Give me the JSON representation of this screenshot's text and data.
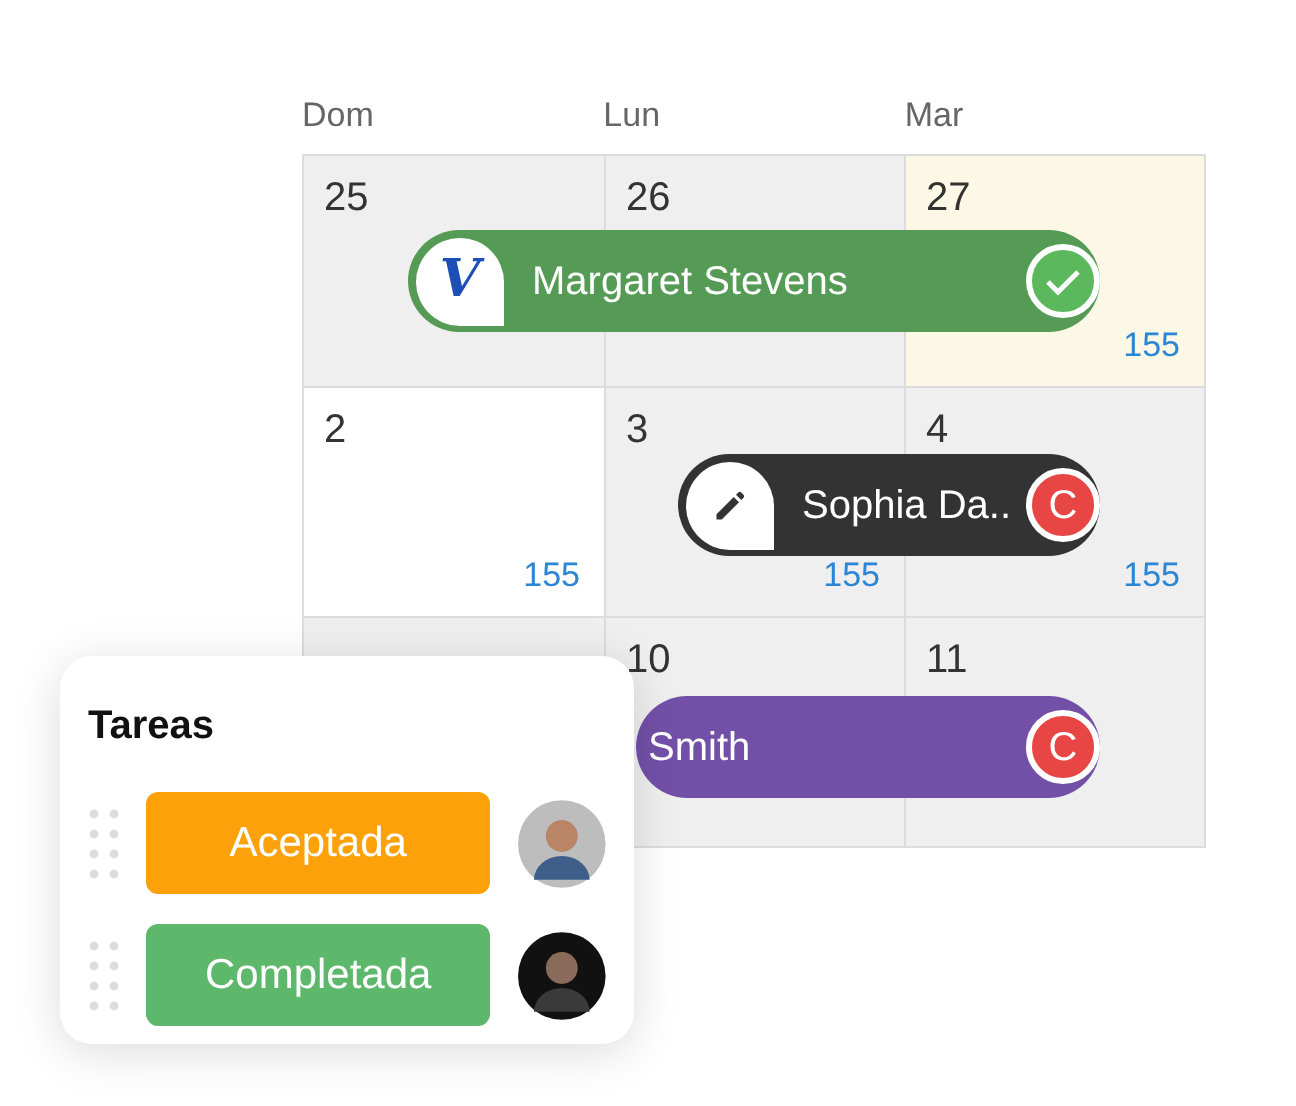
{
  "calendar": {
    "weekdays": [
      "Dom",
      "Lun",
      "Mar"
    ],
    "weeks": [
      {
        "days": [
          {
            "day": "25",
            "kind": "past"
          },
          {
            "day": "26",
            "kind": "past"
          },
          {
            "day": "27",
            "kind": "today",
            "count": "155"
          }
        ],
        "event": {
          "name": "Margaret Stevens",
          "color": "#559b55",
          "lead": {
            "kind": "logo",
            "text": "V"
          },
          "badge": {
            "kind": "check"
          }
        }
      },
      {
        "days": [
          {
            "day": "2",
            "kind": "free",
            "count": "155"
          },
          {
            "day": "3",
            "kind": "past",
            "count": "155"
          },
          {
            "day": "4",
            "kind": "past",
            "count": "155"
          }
        ],
        "event": {
          "name": "Sophia Da..",
          "color": "#333333",
          "lead": {
            "kind": "edit"
          },
          "badge": {
            "kind": "letter",
            "text": "C"
          }
        }
      },
      {
        "days": [
          {
            "kind": "past"
          },
          {
            "day": "10",
            "kind": "past"
          },
          {
            "day": "11",
            "kind": "past"
          }
        ],
        "event": {
          "name": "Smith",
          "color": "#7350a8",
          "badge": {
            "kind": "letter",
            "text": "C"
          }
        }
      }
    ]
  },
  "tasks": {
    "title": "Tareas",
    "items": [
      {
        "label": "Aceptada",
        "color": "#fca10a",
        "kind": "light"
      },
      {
        "label": "Completada",
        "color": "#5db86b",
        "kind": "dark"
      }
    ]
  }
}
